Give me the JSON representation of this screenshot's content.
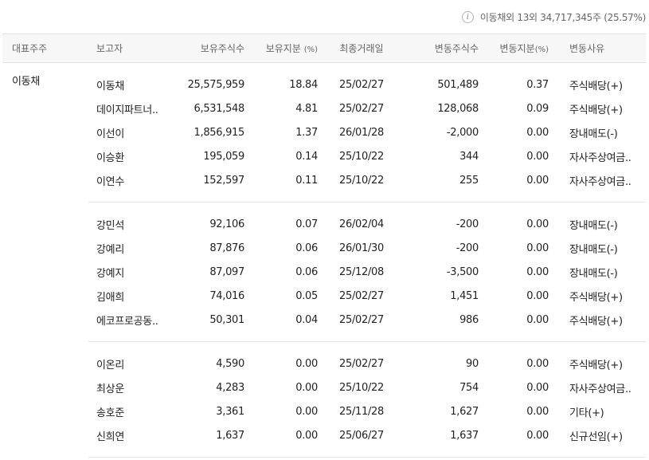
{
  "summary": {
    "text": "이동채외 13외 34,717,345주 (25.57%)",
    "icon": "info-icon"
  },
  "columns": {
    "rep": "대표주주",
    "reporter": "보고자",
    "shares": "보유주식수",
    "ratio": "보유지분",
    "ratio_unit": "(%)",
    "last_trade": "최종거래일",
    "change_shares": "변동주식수",
    "change_ratio": "변동지분",
    "change_ratio_unit": "(%)",
    "reason": "변동사유"
  },
  "groups": [
    {
      "rep": "이동채",
      "rows": [
        {
          "reporter": "이동채",
          "shares": "25,575,959",
          "ratio": "18.84",
          "date": "25/02/27",
          "change": "501,489",
          "change_ratio": "0.37",
          "reason": "주식배당(+)"
        },
        {
          "reporter": "데이지파트너..",
          "shares": "6,531,548",
          "ratio": "4.81",
          "date": "25/02/27",
          "change": "128,068",
          "change_ratio": "0.09",
          "reason": "주식배당(+)"
        },
        {
          "reporter": "이선이",
          "shares": "1,856,915",
          "ratio": "1.37",
          "date": "26/01/28",
          "change": "-2,000",
          "change_ratio": "0.00",
          "reason": "장내매도(-)"
        },
        {
          "reporter": "이승환",
          "shares": "195,059",
          "ratio": "0.14",
          "date": "25/10/22",
          "change": "344",
          "change_ratio": "0.00",
          "reason": "자사주상여금.."
        },
        {
          "reporter": "이연수",
          "shares": "152,597",
          "ratio": "0.11",
          "date": "25/10/22",
          "change": "255",
          "change_ratio": "0.00",
          "reason": "자사주상여금.."
        }
      ]
    },
    {
      "rep": "",
      "rows": [
        {
          "reporter": "강민석",
          "shares": "92,106",
          "ratio": "0.07",
          "date": "26/02/04",
          "change": "-200",
          "change_ratio": "0.00",
          "reason": "장내매도(-)"
        },
        {
          "reporter": "강예리",
          "shares": "87,876",
          "ratio": "0.06",
          "date": "26/01/30",
          "change": "-200",
          "change_ratio": "0.00",
          "reason": "장내매도(-)"
        },
        {
          "reporter": "강예지",
          "shares": "87,097",
          "ratio": "0.06",
          "date": "25/12/08",
          "change": "-3,500",
          "change_ratio": "0.00",
          "reason": "장내매도(-)"
        },
        {
          "reporter": "김애희",
          "shares": "74,016",
          "ratio": "0.05",
          "date": "25/02/27",
          "change": "1,451",
          "change_ratio": "0.00",
          "reason": "주식배당(+)"
        },
        {
          "reporter": "에코프로공동..",
          "shares": "50,301",
          "ratio": "0.04",
          "date": "25/02/27",
          "change": "986",
          "change_ratio": "0.00",
          "reason": "주식배당(+)"
        }
      ]
    },
    {
      "rep": "",
      "rows": [
        {
          "reporter": "이온리",
          "shares": "4,590",
          "ratio": "0.00",
          "date": "25/02/27",
          "change": "90",
          "change_ratio": "0.00",
          "reason": "주식배당(+)"
        },
        {
          "reporter": "최상운",
          "shares": "4,283",
          "ratio": "0.00",
          "date": "25/10/22",
          "change": "754",
          "change_ratio": "0.00",
          "reason": "자사주상여금.."
        },
        {
          "reporter": "송호준",
          "shares": "3,361",
          "ratio": "0.00",
          "date": "25/11/28",
          "change": "1,627",
          "change_ratio": "0.00",
          "reason": "기타(+)"
        },
        {
          "reporter": "신희연",
          "shares": "1,637",
          "ratio": "0.00",
          "date": "25/06/27",
          "change": "1,637",
          "change_ratio": "0.00",
          "reason": "신규선임(+)"
        }
      ]
    }
  ]
}
